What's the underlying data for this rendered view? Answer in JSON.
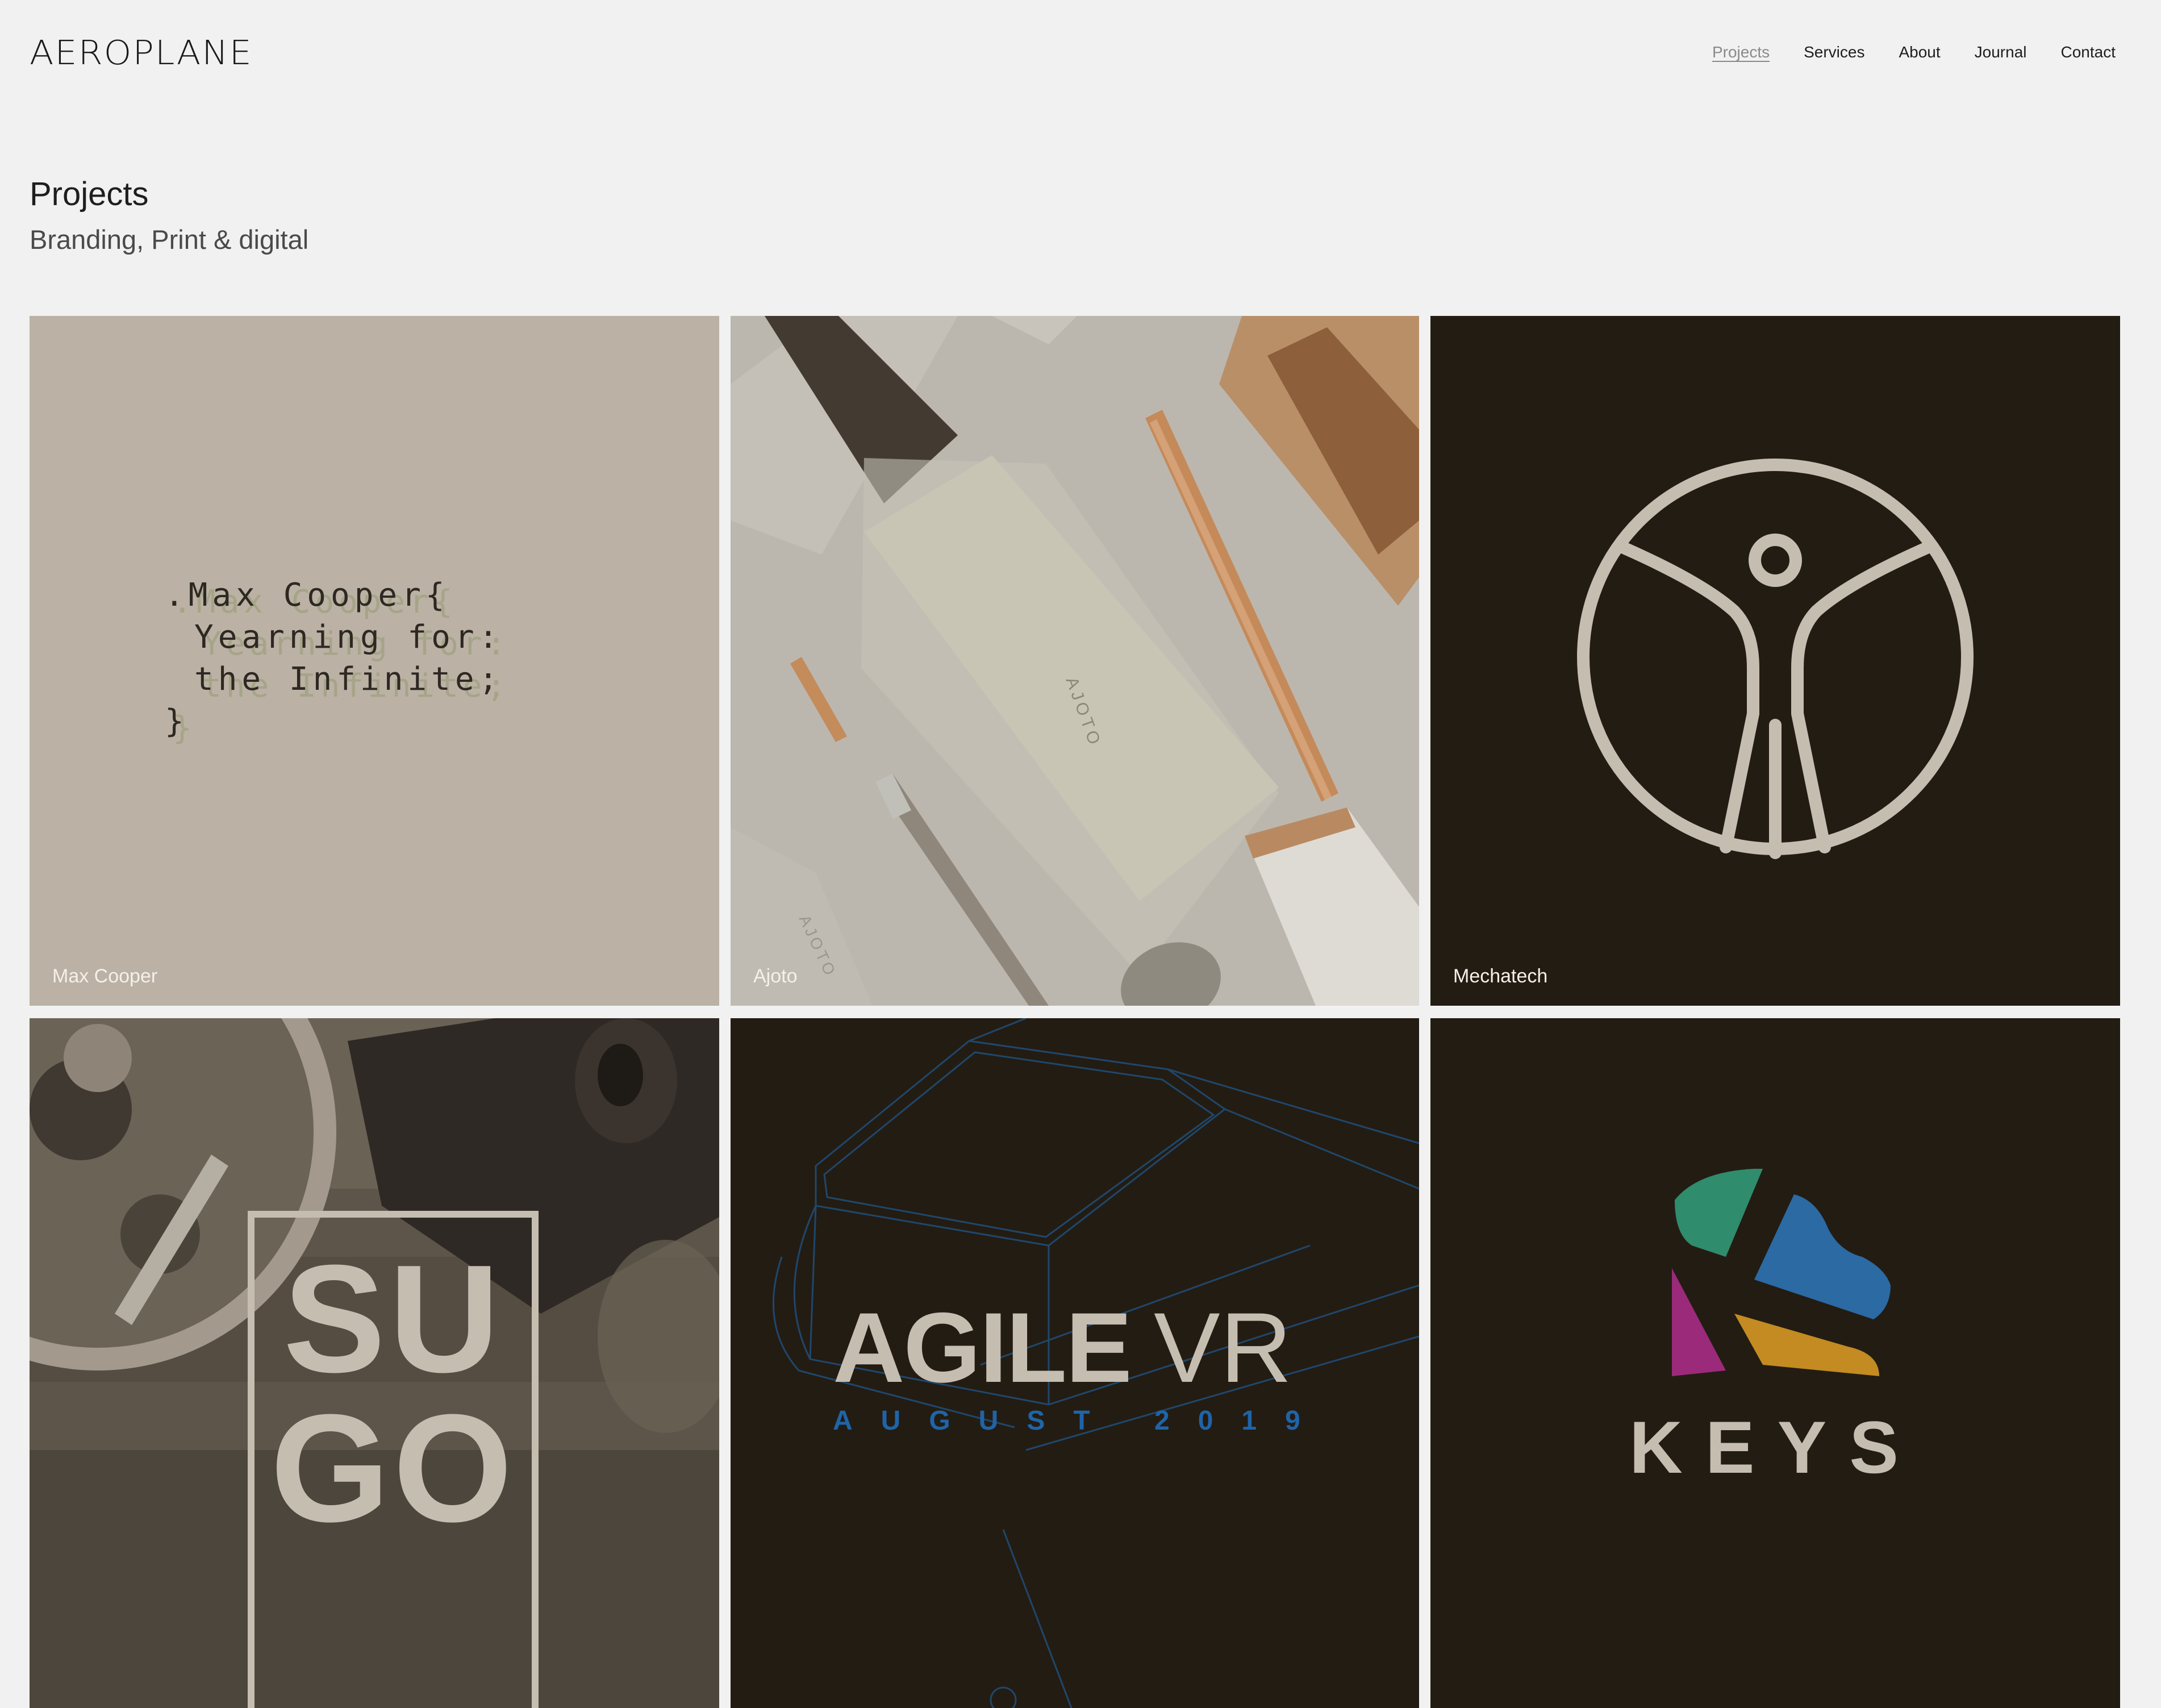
{
  "header": {
    "logo": "AEROPLANE",
    "nav": [
      {
        "label": "Projects",
        "active": true
      },
      {
        "label": "Services",
        "active": false
      },
      {
        "label": "About",
        "active": false
      },
      {
        "label": "Journal",
        "active": false
      },
      {
        "label": "Contact",
        "active": false
      }
    ]
  },
  "page": {
    "title": "Projects",
    "subtitle": "Branding, Print & digital"
  },
  "projects": [
    {
      "label": "Max Cooper",
      "art_lines": [
        ".Max Cooper{",
        "Yearning for:",
        "the Infinite;",
        "}"
      ]
    },
    {
      "label": "Ajoto",
      "art_text": "AJOTO"
    },
    {
      "label": "Mechatech",
      "art_icon": "vitruvian-man-icon"
    },
    {
      "label": "",
      "art_lines": [
        "SU",
        "GO"
      ]
    },
    {
      "label": "",
      "art_title_bold": "AGILE",
      "art_title_light": "VR",
      "art_date": "AUGUST 2019"
    },
    {
      "label": "",
      "art_text": "KEYS",
      "art_icon": "keys-logo-icon"
    }
  ],
  "colors": {
    "background": "#f1f1f1",
    "dark_tile": "#231c13",
    "beige": "#c6bdb1",
    "agile_blue": "#1f64a8",
    "keys_green": "#2f8c6c",
    "keys_blue": "#2b6aa3",
    "keys_magenta": "#9c2a7a",
    "keys_gold": "#c38b21"
  }
}
